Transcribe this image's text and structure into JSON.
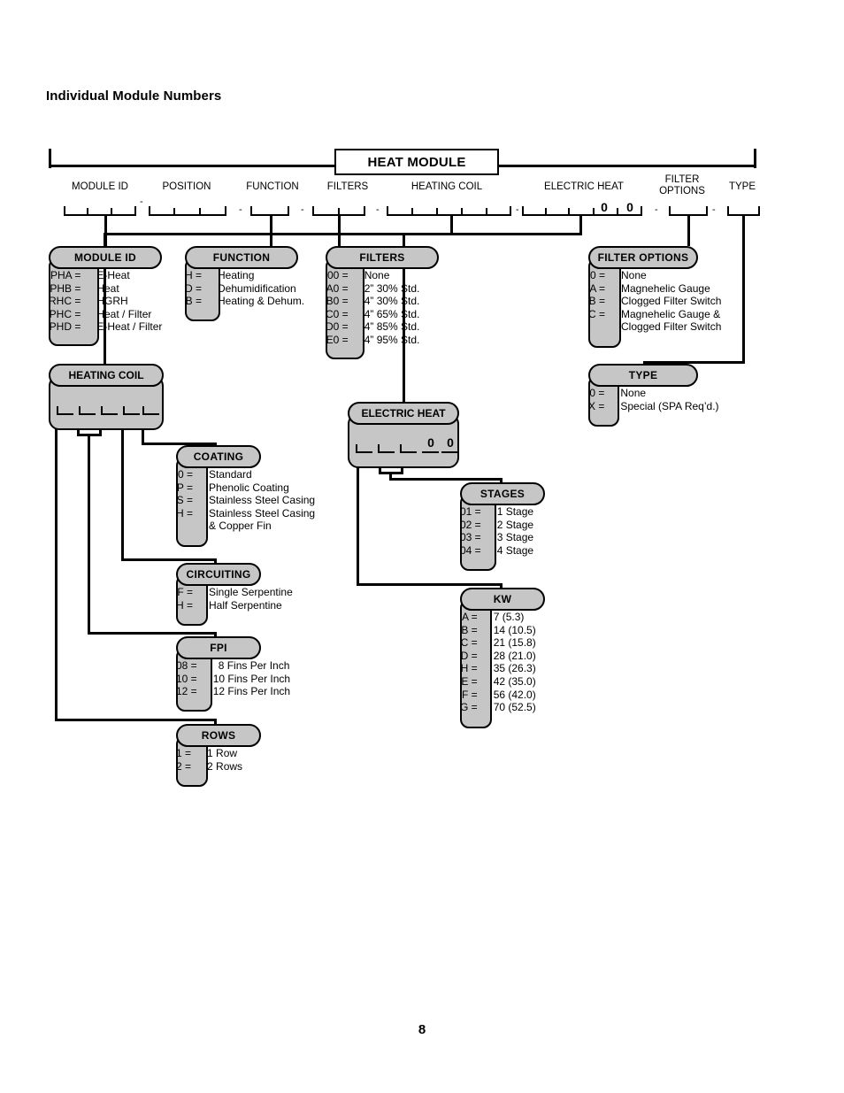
{
  "page": {
    "title": "Individual Module Numbers",
    "number": "8"
  },
  "rail": {
    "center_label": "HEAT MODULE"
  },
  "captions": [
    {
      "label": "MODULE ID"
    },
    {
      "label": "POSITION"
    },
    {
      "label": "FUNCTION"
    },
    {
      "label": "FILTERS"
    },
    {
      "label": "HEATING COIL"
    },
    {
      "label": "ELECTRIC HEAT"
    },
    {
      "label": "FILTER\nOPTIONS"
    },
    {
      "label": "TYPE"
    }
  ],
  "slot_values": {
    "electric_heat_fixed_1": "0",
    "electric_heat_fixed_2": "0",
    "separator": "-"
  },
  "boxes": {
    "module_id": {
      "title": "MODULE ID",
      "rows": [
        {
          "code": "PHA =",
          "desc": "E-Heat"
        },
        {
          "code": "PHB =",
          "desc": "Heat"
        },
        {
          "code": "RHC =",
          "desc": "HGRH"
        },
        {
          "code": "PHC =",
          "desc": "Heat / Filter"
        },
        {
          "code": "PHD =",
          "desc": "E-Heat / Filter"
        }
      ]
    },
    "function": {
      "title": "FUNCTION",
      "rows": [
        {
          "code": "H =",
          "desc": "Heating"
        },
        {
          "code": "D =",
          "desc": "Dehumidification"
        },
        {
          "code": "B =",
          "desc": "Heating & Dehum."
        }
      ]
    },
    "filters": {
      "title": "FILTERS",
      "rows": [
        {
          "code": "00 =",
          "desc": "None"
        },
        {
          "code": "A0 =",
          "desc": "2” 30% Std."
        },
        {
          "code": "B0 =",
          "desc": "4” 30% Std."
        },
        {
          "code": "C0 =",
          "desc": "4” 65% Std."
        },
        {
          "code": "D0 =",
          "desc": "4” 85% Std."
        },
        {
          "code": "E0 =",
          "desc": "4” 95% Std."
        }
      ]
    },
    "filter_options": {
      "title": "FILTER OPTIONS",
      "rows": [
        {
          "code": "0 =",
          "desc": "None"
        },
        {
          "code": "A =",
          "desc": "Magnehelic Gauge"
        },
        {
          "code": "B =",
          "desc": "Clogged Filter Switch"
        },
        {
          "code": "C =",
          "desc": "Magnehelic Gauge &"
        },
        {
          "code": "",
          "desc": "Clogged Filter Switch"
        }
      ]
    },
    "type": {
      "title": "TYPE",
      "rows": [
        {
          "code": "0 =",
          "desc": "None"
        },
        {
          "code": "X =",
          "desc": "Special (SPA Req’d.)"
        }
      ]
    },
    "heating_coil": {
      "title": "HEATING COIL",
      "slot_count": 5
    },
    "electric_heat": {
      "title": "ELECTRIC HEAT",
      "slot_count": 3,
      "fixed": [
        "0",
        "0"
      ]
    },
    "coating": {
      "title": "COATING",
      "rows": [
        {
          "code": "0 =",
          "desc": "Standard"
        },
        {
          "code": "P =",
          "desc": "Phenolic Coating"
        },
        {
          "code": "S =",
          "desc": "Stainless Steel Casing"
        },
        {
          "code": "H =",
          "desc": "Stainless Steel Casing"
        },
        {
          "code": "",
          "desc": "& Copper Fin"
        }
      ]
    },
    "circuiting": {
      "title": "CIRCUITING",
      "rows": [
        {
          "code": "F =",
          "desc": "Single Serpentine"
        },
        {
          "code": "H =",
          "desc": "Half Serpentine"
        }
      ]
    },
    "fpi": {
      "title": "FPI",
      "rows": [
        {
          "code": "08 =",
          "desc": "8 Fins Per Inch"
        },
        {
          "code": "10 =",
          "desc": "10 Fins Per Inch"
        },
        {
          "code": "12 =",
          "desc": "12 Fins Per Inch"
        }
      ]
    },
    "rows_box": {
      "title": "ROWS",
      "rows": [
        {
          "code": "1 =",
          "desc": "1 Row"
        },
        {
          "code": "2 =",
          "desc": "2 Rows"
        }
      ]
    },
    "stages": {
      "title": "STAGES",
      "rows": [
        {
          "code": "01 =",
          "desc": "1 Stage"
        },
        {
          "code": "02 =",
          "desc": "2 Stage"
        },
        {
          "code": "03 =",
          "desc": "3 Stage"
        },
        {
          "code": "04 =",
          "desc": "4 Stage"
        }
      ]
    },
    "kw": {
      "title": "KW",
      "rows": [
        {
          "code": "A =",
          "desc": "7 (5.3)"
        },
        {
          "code": "B =",
          "desc": "14 (10.5)"
        },
        {
          "code": "C =",
          "desc": "21 (15.8)"
        },
        {
          "code": "D =",
          "desc": "28 (21.0)"
        },
        {
          "code": "H =",
          "desc": "35 (26.3)"
        },
        {
          "code": "E =",
          "desc": "42 (35.0)"
        },
        {
          "code": "F =",
          "desc": "56 (42.0)"
        },
        {
          "code": "G =",
          "desc": "70 (52.5)"
        }
      ]
    }
  },
  "colors": {
    "panel": "#c6c6c6",
    "line": "#000000",
    "background": "#ffffff"
  }
}
